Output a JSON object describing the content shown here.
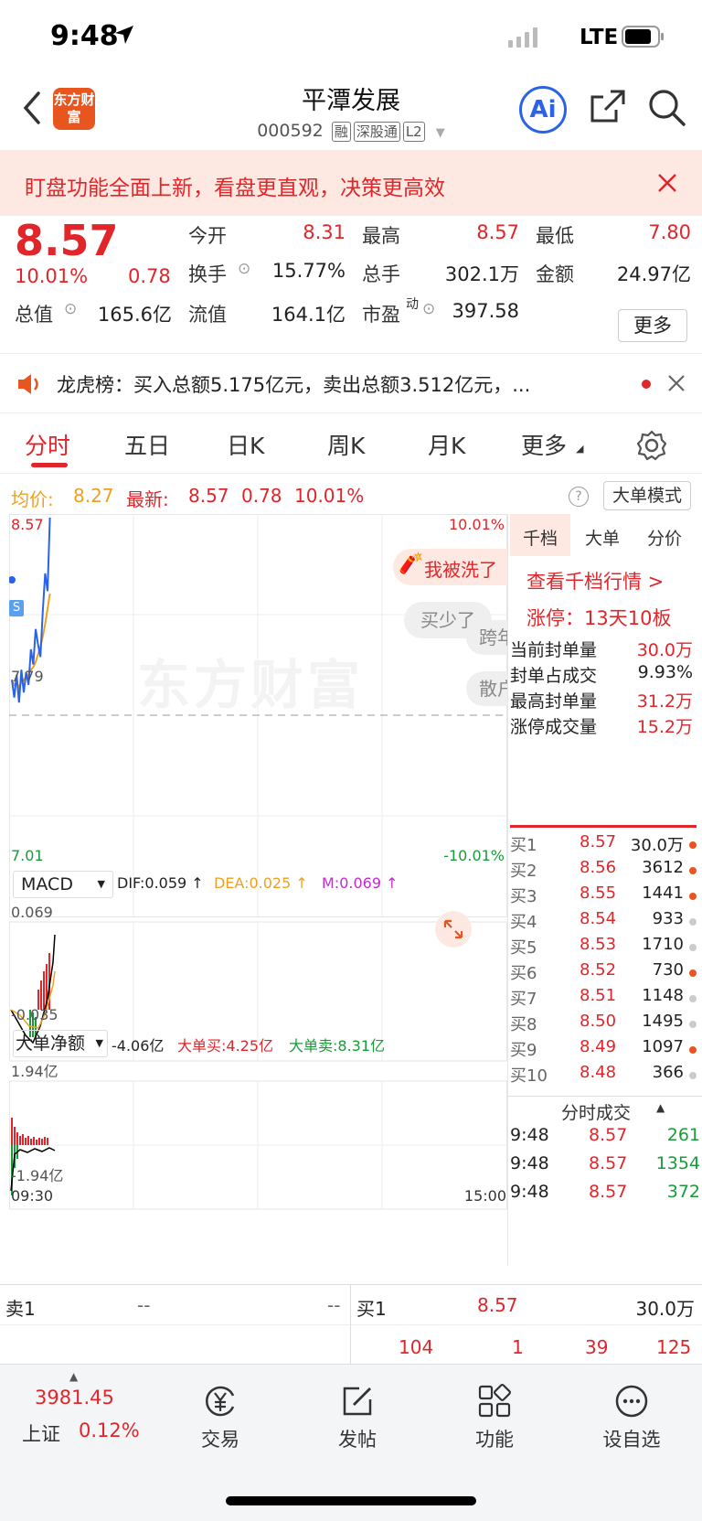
{
  "status_bar": {
    "time": "9:48",
    "network": "LTE"
  },
  "header": {
    "logo_text": "东方财富",
    "title": "平潭发展",
    "code": "000592",
    "tags": [
      "融",
      "深股通",
      "L2"
    ],
    "ai_label": "Ai"
  },
  "banner": {
    "text": "盯盘功能全面上新，看盘更直观，决策更高效"
  },
  "quote": {
    "price": "8.57",
    "change_pct": "10.01%",
    "change": "0.78",
    "open_label": "今开",
    "open": "8.31",
    "high_label": "最高",
    "high": "8.57",
    "low_label": "最低",
    "low": "7.80",
    "turnover_label": "换手",
    "turnover": "15.77%",
    "volume_label": "总手",
    "volume": "302.1万",
    "amount_label": "金额",
    "amount": "24.97亿",
    "mktcap_label": "总值",
    "mktcap": "165.6亿",
    "float_label": "流值",
    "float": "164.1亿",
    "pe_label": "市盈",
    "pe_sup": "动",
    "pe": "397.58",
    "more_label": "更多"
  },
  "dragon": {
    "text": "龙虎榜：买入总额5.175亿元，卖出总额3.512亿元，..."
  },
  "tabs": [
    "分时",
    "五日",
    "日K",
    "周K",
    "月K",
    "更多"
  ],
  "avg_line": {
    "avg_label": "均价:",
    "avg": "8.27",
    "latest_label": "最新:",
    "latest": "8.57",
    "chg": "0.78",
    "pct": "10.01%",
    "mode_label": "大单模式"
  },
  "chart": {
    "price_top": "8.57",
    "pct_top": "10.01%",
    "price_mid": "7.79",
    "price_bottom": "7.01",
    "pct_bottom": "-10.01%",
    "watermark": "东方财富",
    "bubble1": "我被洗了",
    "bubble2": "买少了",
    "bubble3": "跨年",
    "bubble4": "散户",
    "s_marker": "S",
    "macd_label": "MACD",
    "dif": "DIF:0.059 ↑",
    "dea": "DEA:0.025 ↑",
    "m": "M:0.069 ↑",
    "macd_top": "0.069",
    "macd_bottom": "-0.035",
    "big_label": "大单净额",
    "big_net": "-4.06亿",
    "big_buy": "大单买:4.25亿",
    "big_sell": "大单卖:8.31亿",
    "big_top": "1.94亿",
    "big_bottom": "-1.94亿",
    "time_start": "09:30",
    "time_end": "15:00",
    "price_line": [
      7.93,
      7.86,
      7.95,
      7.84,
      7.97,
      7.88,
      7.96,
      7.91,
      8.05,
      7.99,
      8.13,
      8.07,
      8.02,
      8.2,
      8.35,
      8.28,
      8.57
    ],
    "avg_price_line": [
      7.93,
      7.91,
      7.92,
      7.9,
      7.92,
      7.93,
      7.94,
      7.95,
      7.97,
      7.98,
      8.0,
      8.03,
      8.06,
      8.1,
      8.15,
      8.21,
      8.27
    ]
  },
  "side": {
    "tabs": [
      "千档",
      "大单",
      "分价"
    ],
    "link": "查看千档行情 >",
    "limit_up": "涨停：13天10板",
    "rows": [
      {
        "label": "当前封单量",
        "value": "30.0万"
      },
      {
        "label": "封单占成交",
        "value": "9.93%"
      },
      {
        "label": "最高封单量",
        "value": "31.2万"
      },
      {
        "label": "涨停成交量",
        "value": "15.2万"
      }
    ],
    "book": [
      {
        "label": "买1",
        "price": "8.57",
        "vol": "30.0万"
      },
      {
        "label": "买2",
        "price": "8.56",
        "vol": "3612"
      },
      {
        "label": "买3",
        "price": "8.55",
        "vol": "1441"
      },
      {
        "label": "买4",
        "price": "8.54",
        "vol": "933"
      },
      {
        "label": "买5",
        "price": "8.53",
        "vol": "1710"
      },
      {
        "label": "买6",
        "price": "8.52",
        "vol": "730"
      },
      {
        "label": "买7",
        "price": "8.51",
        "vol": "1148"
      },
      {
        "label": "买8",
        "price": "8.50",
        "vol": "1495"
      },
      {
        "label": "买9",
        "price": "8.49",
        "vol": "1097"
      },
      {
        "label": "买10",
        "price": "8.48",
        "vol": "366"
      }
    ],
    "trades_title": "分时成交",
    "trades": [
      {
        "time": "9:48",
        "price": "8.57",
        "vol": "261"
      },
      {
        "time": "9:48",
        "price": "8.57",
        "vol": "1354"
      },
      {
        "time": "9:48",
        "price": "8.57",
        "vol": "372"
      }
    ]
  },
  "bottom": {
    "sell1_label": "卖1",
    "sell1_price": "--",
    "sell1_vol": "--",
    "buy1_label": "买1",
    "buy1_price": "8.57",
    "buy1_vol": "30.0万",
    "queue": [
      "104",
      "1",
      "39",
      "125"
    ]
  },
  "nav": {
    "index_value": "3981.45",
    "index_name": "上证",
    "index_pct": "0.12%",
    "items": [
      "交易",
      "发帖",
      "功能",
      "设自选"
    ]
  }
}
